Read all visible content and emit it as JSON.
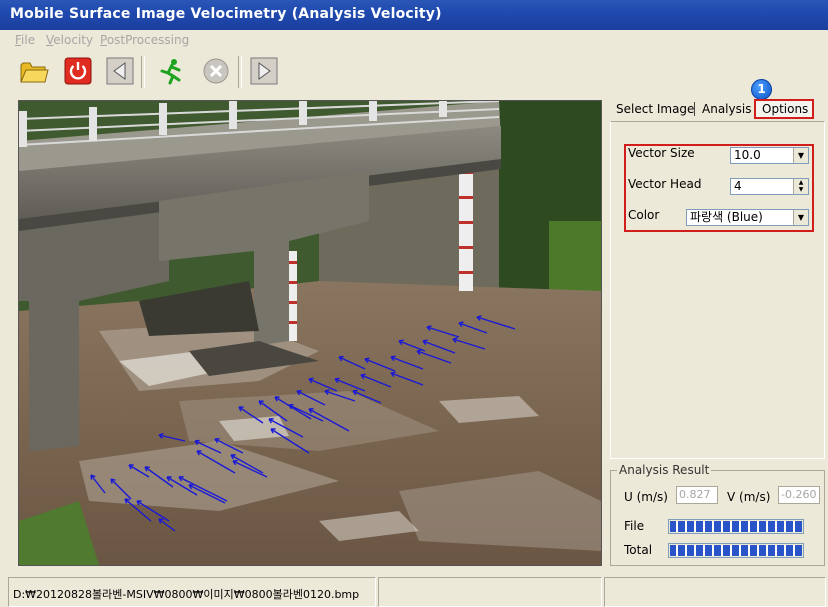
{
  "window": {
    "title": "Mobile Surface Image Velocimetry (Analysis Velocity)"
  },
  "menu": {
    "file": {
      "first": "F",
      "rest": "ile"
    },
    "velocity": {
      "first": "V",
      "rest": "elocity"
    },
    "postprocessing": {
      "first": "P",
      "rest": "ostProcessing"
    }
  },
  "toolbar": {
    "buttons": [
      "folder-open-icon",
      "power-icon",
      "back-arrow-icon",
      "run-icon",
      "stop-icon",
      "play-arrow-icon"
    ]
  },
  "tabs": {
    "items": [
      "Select Image",
      "Analysis",
      "Options"
    ],
    "active": "Options",
    "badge": "1"
  },
  "options": {
    "vector_size_label": "Vector Size",
    "vector_size_value": "10.0",
    "vector_head_label": "Vector Head",
    "vector_head_value": "4",
    "color_label": "Color",
    "color_value": "파랑색 (Blue)"
  },
  "result": {
    "legend": "Analysis Result",
    "u_label": "U (m/s)",
    "u_value": "0.827",
    "v_label": "V (m/s)",
    "v_value": "-0.260",
    "file_label": "File",
    "file_progress": 1.0,
    "total_label": "Total",
    "total_progress": 1.0
  },
  "status": {
    "path": "D:₩20120828볼라벤-MSIV₩0800₩이미지₩0800볼라벤0120.bmp",
    "cell2": "",
    "cell3": ""
  },
  "colors": {
    "vector": "#1a1ad6",
    "highlight": "#d21d1d",
    "titlebar": "#204ab0"
  }
}
